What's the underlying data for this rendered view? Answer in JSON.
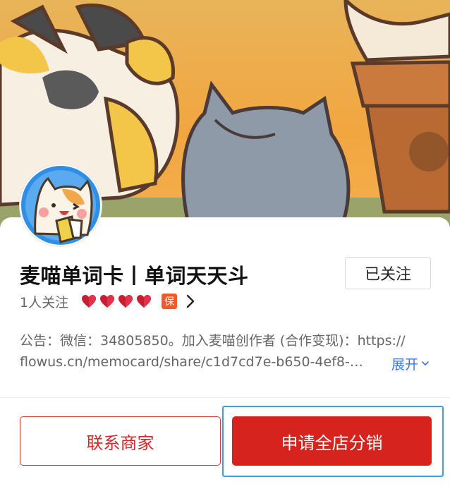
{
  "shop": {
    "title": "麦喵单词卡丨单词天天斗",
    "follower_count": "1人关注",
    "hearts": 4,
    "bao_badge": "保",
    "follow_label": "已关注"
  },
  "notice": {
    "line1": "公告：微信：34805850。加入麦喵创作者 (合作变现)：https://",
    "line2": "flowus.cn/memocard/share/c1d7cd7e-b650-4ef8-…",
    "expand_label": "展开"
  },
  "actions": {
    "contact_label": "联系商家",
    "distribute_label": "申请全店分销"
  },
  "colors": {
    "accent_red": "#d7231e",
    "link_blue": "#3a73e0",
    "badge_orange": "#f05a28",
    "focus_blue": "#3aa0e0"
  },
  "icons": {
    "hearts": "heart-icon",
    "more": "chevron-right-icon",
    "expand": "chevron-down-icon"
  }
}
